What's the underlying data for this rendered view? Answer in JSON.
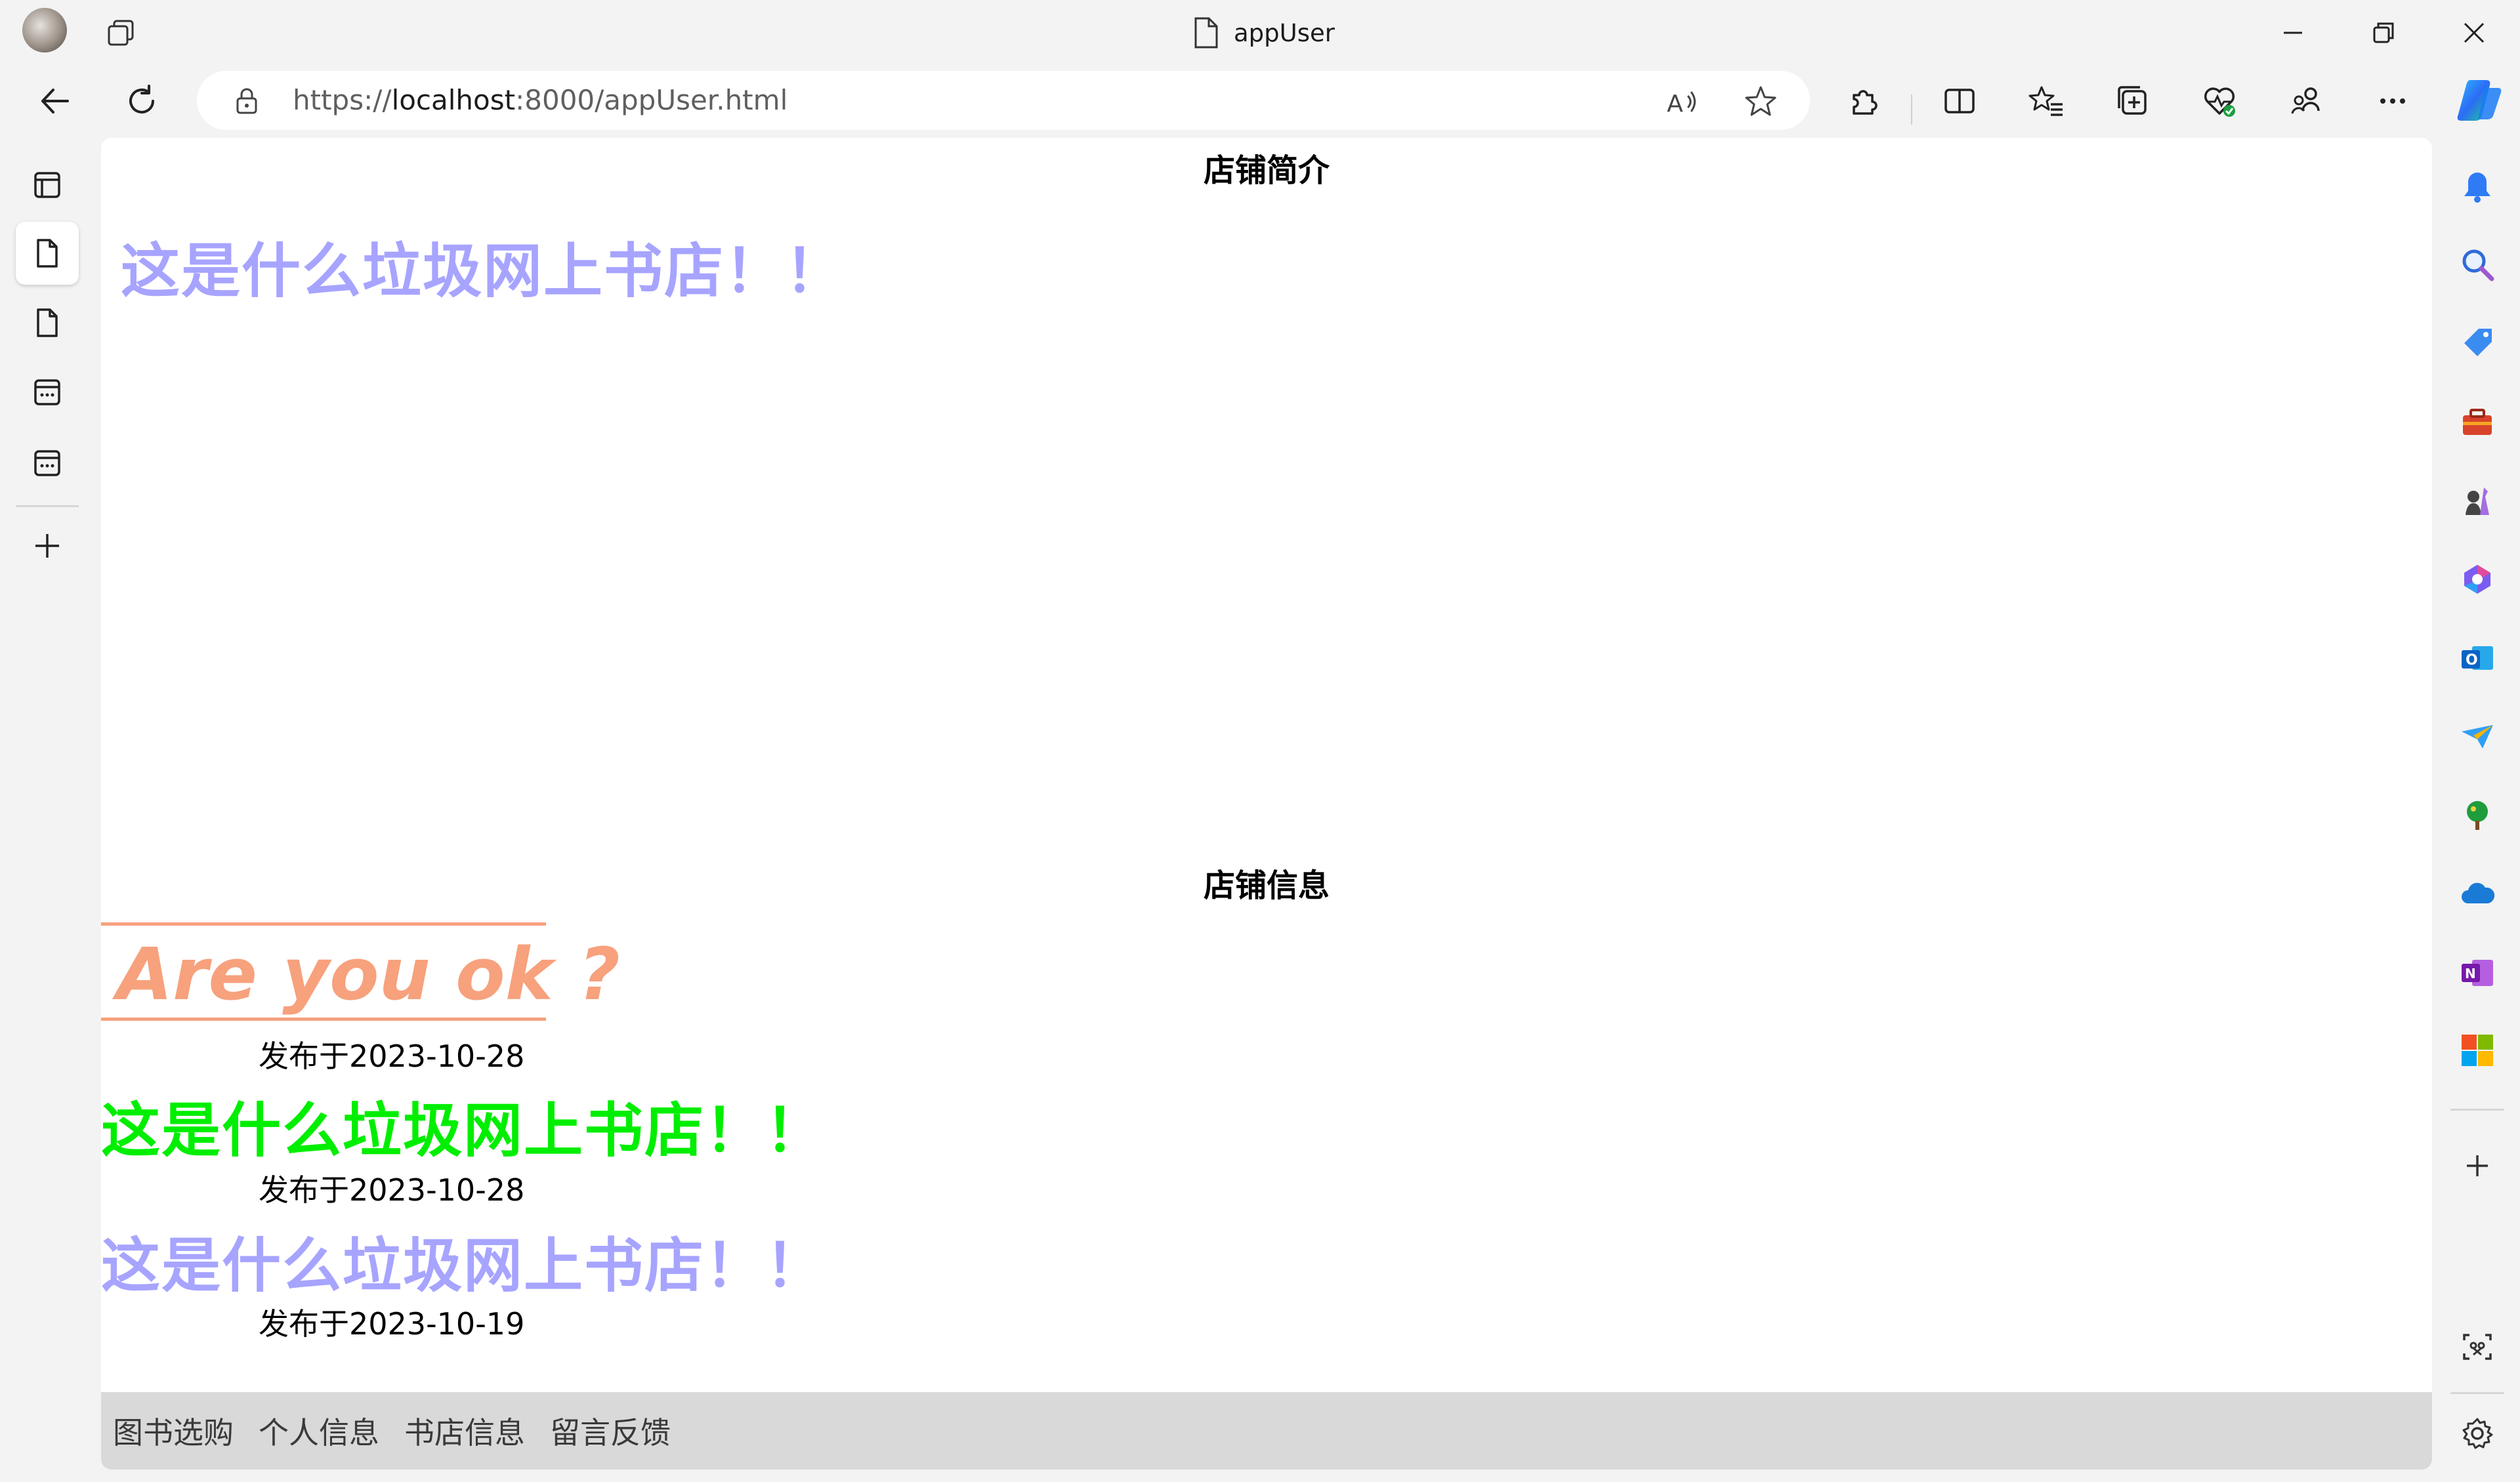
{
  "window": {
    "title": "appUser"
  },
  "address_bar": {
    "scheme": "https://",
    "host": "localhost",
    "rest": ":8000/appUser.html"
  },
  "colors": {
    "intro_text": "#a7a4ff",
    "ok_text": "#f7a17d",
    "post_green": "#00ee00",
    "post_purple": "#a7a4ff"
  },
  "page": {
    "intro_title": "店铺简介",
    "intro_text": "这是什么垃圾网上书店！！",
    "info_title": "店铺信息",
    "featured": {
      "text": "Are you ok ?",
      "date": "发布于2023-10-28"
    },
    "posts": [
      {
        "text": "这是什么垃圾网上书店！！",
        "date": "发布于2023-10-28"
      },
      {
        "text": "这是什么垃圾网上书店！！",
        "date": "发布于2023-10-19"
      }
    ],
    "footer_nav": [
      "图书选购",
      "个人信息",
      "书店信息",
      "留言反馈"
    ]
  }
}
